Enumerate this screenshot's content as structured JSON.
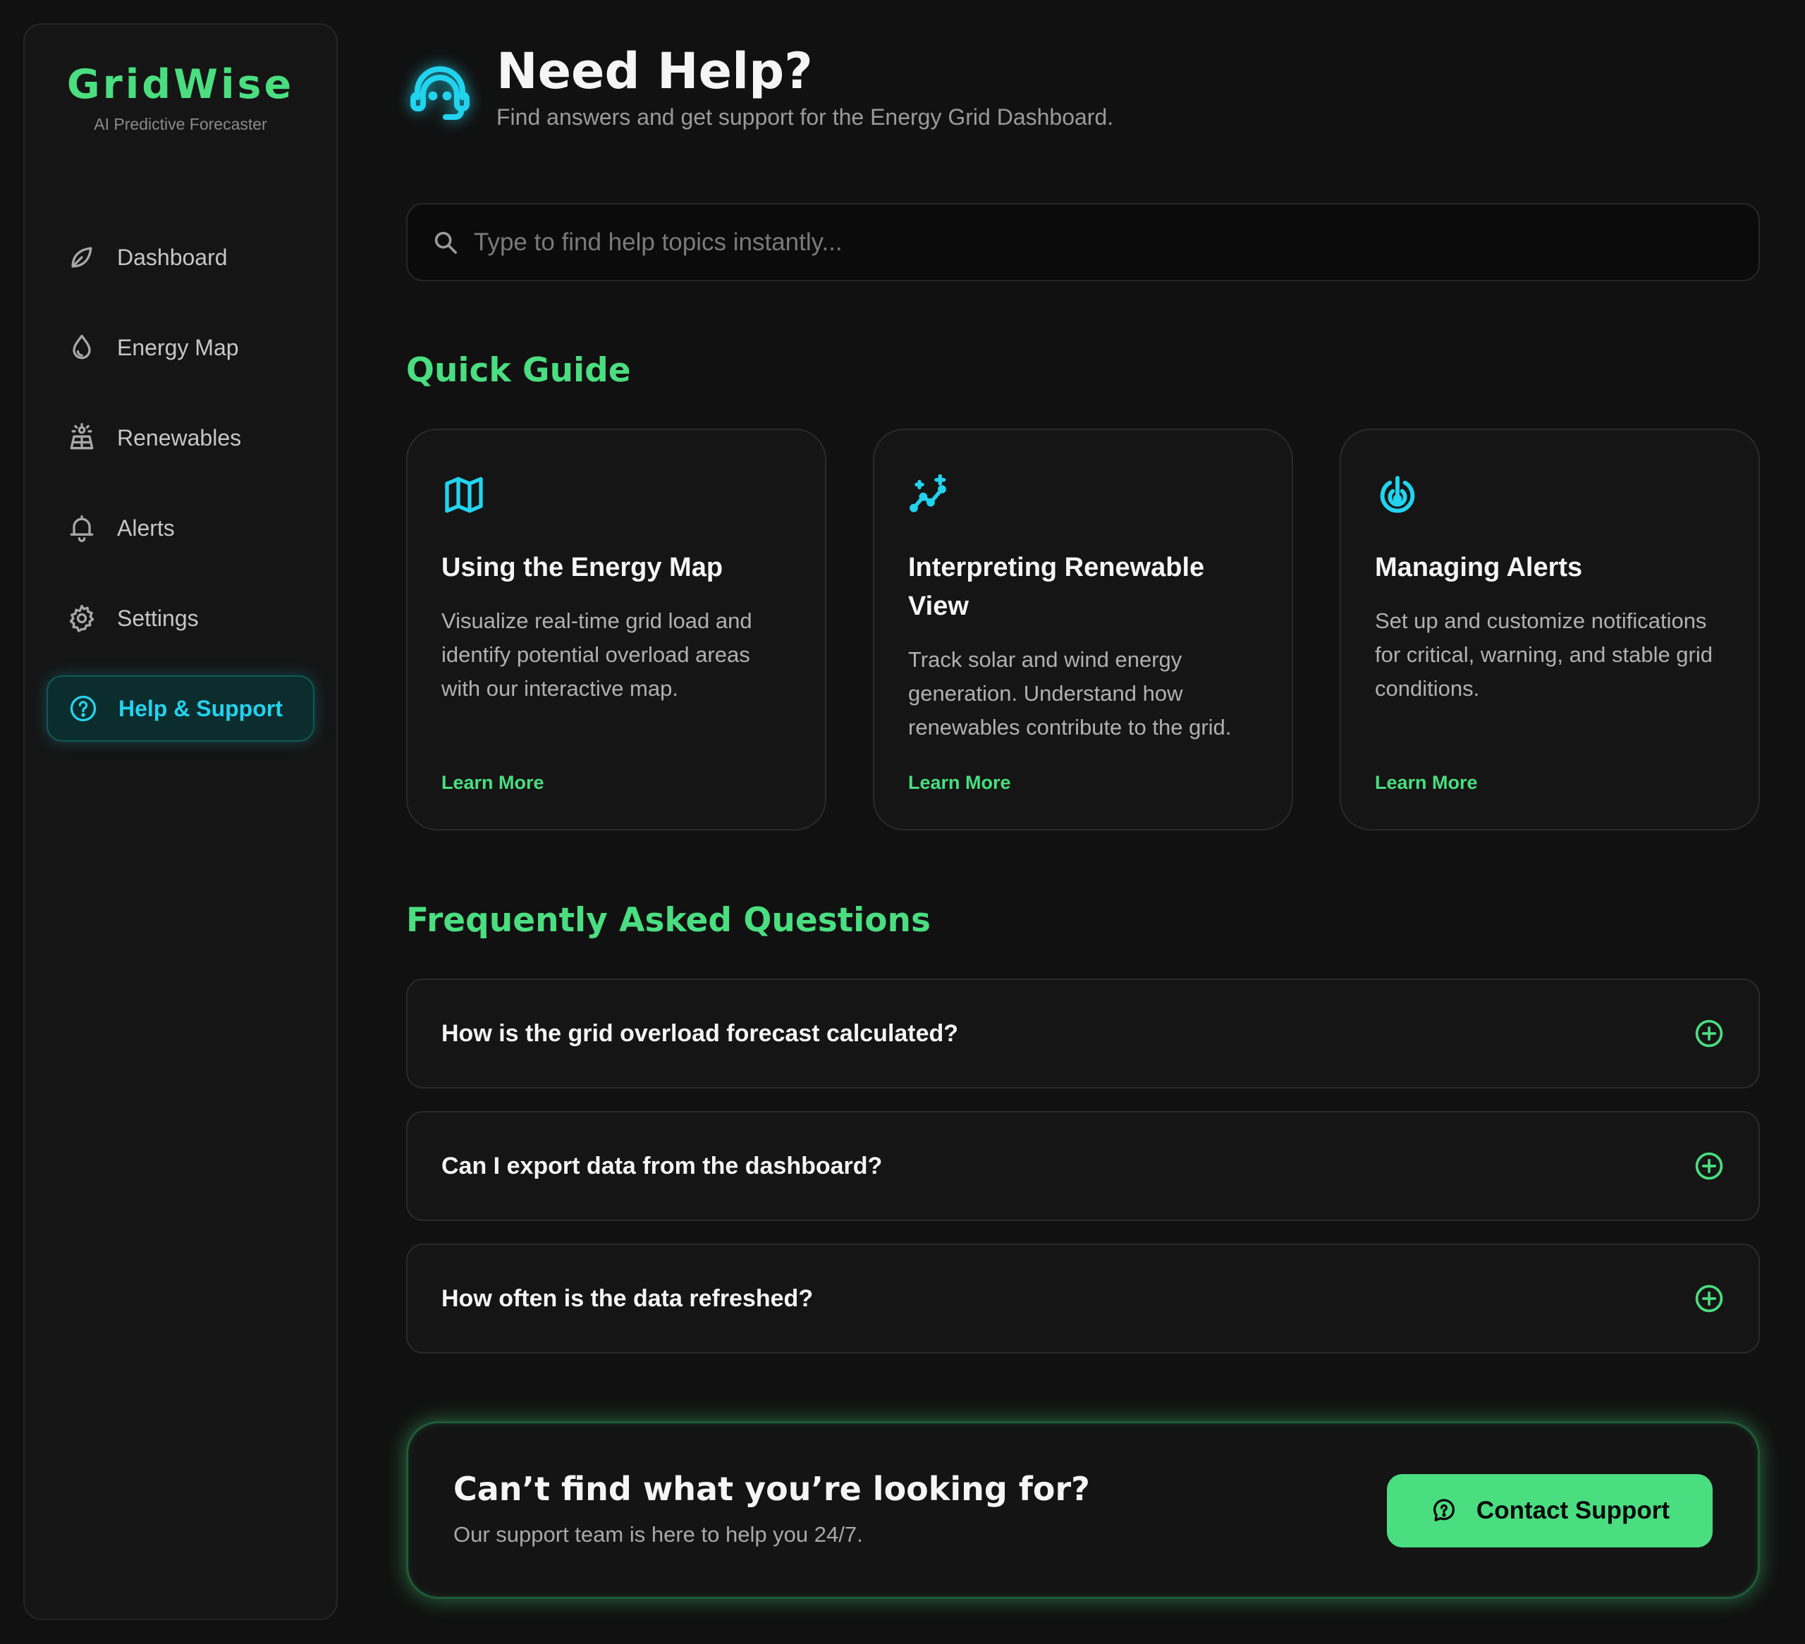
{
  "brand": {
    "name": "GridWise",
    "tagline": "AI Predictive Forecaster"
  },
  "sidebar": {
    "items": [
      {
        "label": "Dashboard",
        "icon": "leaf-icon",
        "active": false
      },
      {
        "label": "Energy Map",
        "icon": "droplet-icon",
        "active": false
      },
      {
        "label": "Renewables",
        "icon": "solar-panel-icon",
        "active": false
      },
      {
        "label": "Alerts",
        "icon": "bell-icon",
        "active": false
      },
      {
        "label": "Settings",
        "icon": "gear-icon",
        "active": false
      },
      {
        "label": "Help & Support",
        "icon": "help-circle-icon",
        "active": true
      }
    ]
  },
  "header": {
    "icon": "headset-icon",
    "title": "Need Help?",
    "subtitle": "Find answers and get support for the Energy Grid Dashboard."
  },
  "search": {
    "placeholder": "Type to find help topics instantly...",
    "value": ""
  },
  "quick_guide": {
    "title": "Quick Guide",
    "cards": [
      {
        "icon": "map-icon",
        "title": "Using the Energy Map",
        "description": "Visualize real-time grid load and identify potential overload areas with our interactive map.",
        "link": "Learn More"
      },
      {
        "icon": "sparkle-chart-icon",
        "title": "Interpreting Renewable View",
        "description": "Track solar and wind energy generation. Understand how renewables contribute to the grid.",
        "link": "Learn More"
      },
      {
        "icon": "target-alert-icon",
        "title": "Managing Alerts",
        "description": "Set up and customize notifications for critical, warning, and stable grid conditions.",
        "link": "Learn More"
      }
    ]
  },
  "faq": {
    "title": "Frequently Asked Questions",
    "items": [
      {
        "question": "How is the grid overload forecast calculated?",
        "icon": "plus-circle-icon"
      },
      {
        "question": "Can I export data from the dashboard?",
        "icon": "plus-circle-icon"
      },
      {
        "question": "How often is the data refreshed?",
        "icon": "plus-circle-icon"
      }
    ]
  },
  "cta": {
    "title": "Can’t find what you’re looking for?",
    "subtitle": "Our support team is here to help you 24/7.",
    "button_label": "Contact Support",
    "button_icon": "help-bubble-icon"
  },
  "colors": {
    "background": "#111111",
    "panel": "#151515",
    "accent_green": "#4ade80",
    "accent_cyan": "#22d3ee",
    "text_primary": "#f5f5f5",
    "text_muted": "#9a9a9a"
  }
}
